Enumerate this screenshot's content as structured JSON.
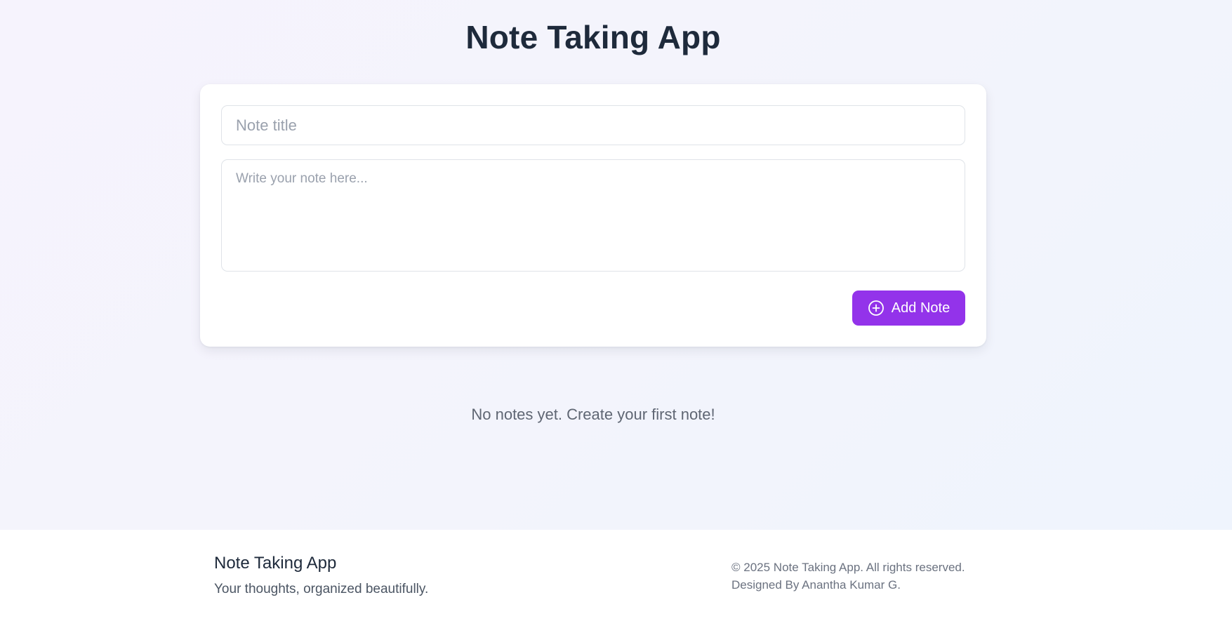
{
  "header": {
    "title": "Note Taking App"
  },
  "form": {
    "title_placeholder": "Note title",
    "title_value": "",
    "body_placeholder": "Write your note here...",
    "body_value": "",
    "add_button_label": "Add Note",
    "add_button_icon": "plus-circle-icon"
  },
  "notes": {
    "items": [],
    "empty_message": "No notes yet. Create your first note!"
  },
  "footer": {
    "brand": "Note Taking App",
    "tagline": "Your thoughts, organized beautifully.",
    "copyright": "© 2025 Note Taking App. All rights reserved.",
    "credit": "Designed By Anantha Kumar G."
  },
  "colors": {
    "accent": "#9333ea",
    "title_text": "#1e2a3b",
    "muted_text": "#6b7280"
  }
}
